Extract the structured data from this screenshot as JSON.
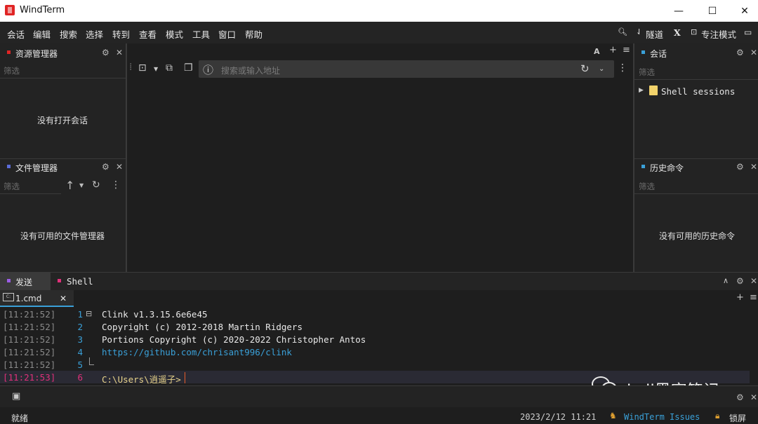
{
  "window": {
    "title": "WindTerm",
    "minimize": "—",
    "maximize": "☐",
    "close": "✕"
  },
  "menu": [
    "会话",
    "编辑",
    "搜索",
    "选择",
    "转到",
    "查看",
    "模式",
    "工具",
    "窗口",
    "帮助"
  ],
  "right_tools": {
    "tunnel": "隧道",
    "x": "X",
    "focus": "专注模式"
  },
  "explorer": {
    "title": "资源管理器",
    "filter_placeholder": "筛选",
    "empty": "没有打开会话"
  },
  "files": {
    "title": "文件管理器",
    "filter_placeholder": "筛选",
    "empty": "没有可用的文件管理器"
  },
  "sessions": {
    "title": "会话",
    "filter_placeholder": "筛选",
    "tree_item": "Shell sessions"
  },
  "history": {
    "title": "历史命令",
    "filter_placeholder": "筛选",
    "empty": "没有可用的历史命令"
  },
  "addressbar": {
    "placeholder": "搜索或输入地址"
  },
  "bottom_tabs": {
    "send": "发送",
    "shell": "Shell"
  },
  "term_tab": {
    "label": "1.cmd",
    "close": "✕"
  },
  "terminal_lines": [
    {
      "ts": "[11:21:52]",
      "ln": "1",
      "text": "Clink v1.3.15.6e6e45"
    },
    {
      "ts": "[11:21:52]",
      "ln": "2",
      "text": "Copyright (c) 2012-2018 Martin Ridgers"
    },
    {
      "ts": "[11:21:52]",
      "ln": "3",
      "text": "Portions Copyright (c) 2020-2022 Christopher Antos"
    },
    {
      "ts": "[11:21:52]",
      "ln": "4",
      "text": "https://github.com/chrisant996/clink"
    },
    {
      "ts": "[11:21:52]",
      "ln": "5",
      "text": ""
    },
    {
      "ts": "[11:21:53]",
      "ln": "6",
      "text": "C:\\Users\\逍遥子>"
    }
  ],
  "watermark": "kali黑客笔记",
  "status": {
    "ready": "就绪",
    "datetime": "2023/2/12 11:21",
    "issues": "WindTerm Issues",
    "lock": "锁屏"
  },
  "colors": {
    "accent_red": "#e02424",
    "link_blue": "#3aa0d8",
    "active_line_pink": "#e0307a",
    "prompt_yellow": "#e8d38a"
  }
}
